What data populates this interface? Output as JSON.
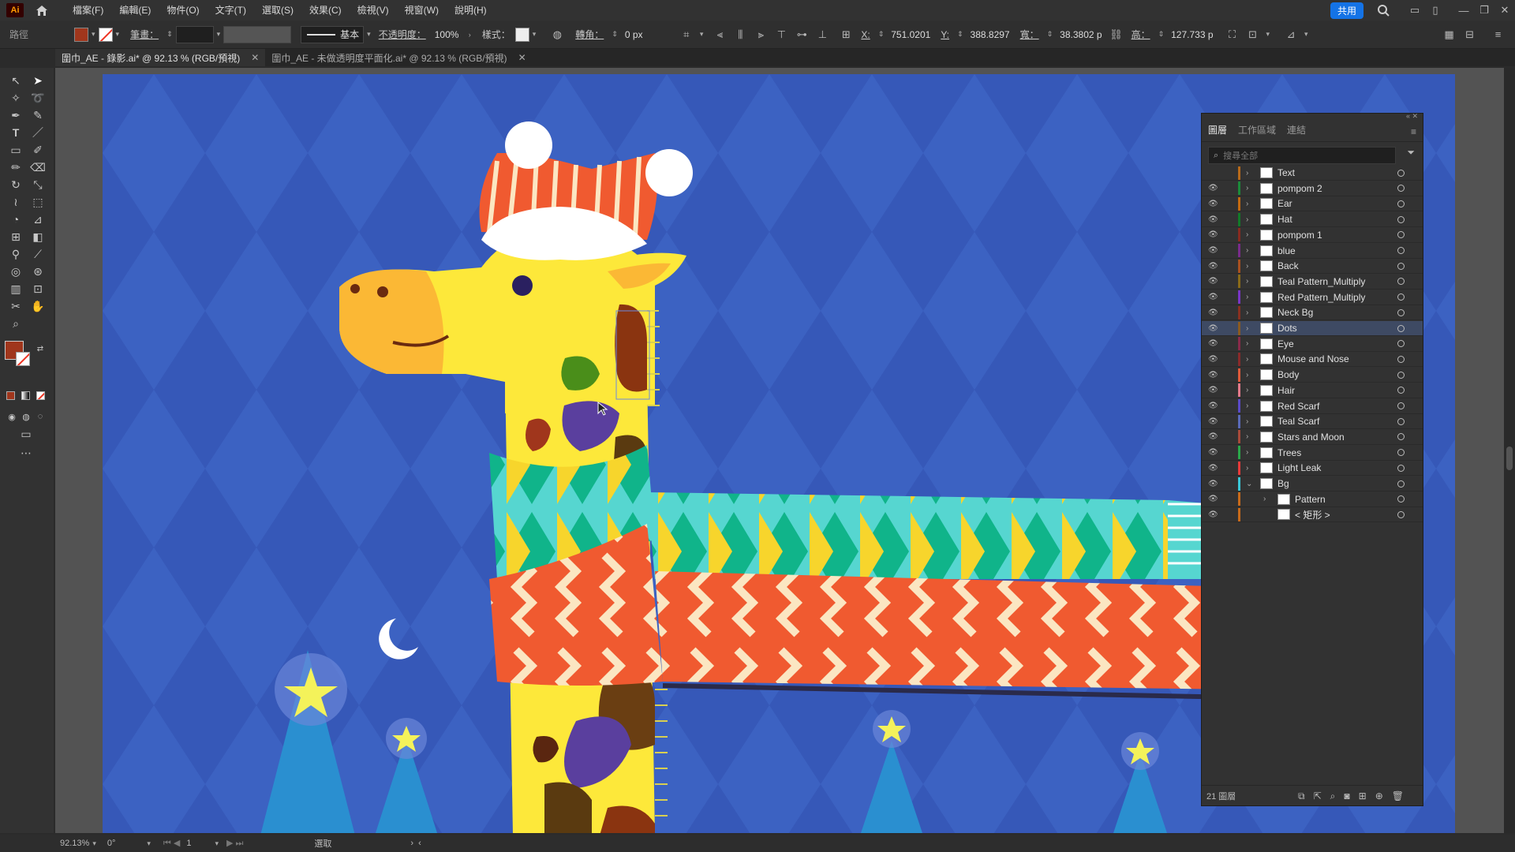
{
  "app": {
    "logo": "Ai"
  },
  "menu": [
    "檔案(F)",
    "編輯(E)",
    "物件(O)",
    "文字(T)",
    "選取(S)",
    "效果(C)",
    "檢視(V)",
    "視窗(W)",
    "說明(H)"
  ],
  "share_label": "共用",
  "control": {
    "path_label": "路徑",
    "stroke_label": "筆畫：",
    "stroke_style": "基本",
    "opacity_label": "不透明度：",
    "opacity_value": "100%",
    "style_label": "樣式：",
    "corner_label": "轉角：",
    "corner_value": "0 px",
    "x_label": "X:",
    "x_value": "751.0201",
    "y_label": "Y:",
    "y_value": "388.8297",
    "w_label": "寬：",
    "w_value": "38.3802 p",
    "h_label": "高：",
    "h_value": "127.733 p"
  },
  "tabs": [
    {
      "label": "圍巾_AE - 錄影.ai* @ 92.13 % (RGB/預視)",
      "active": true
    },
    {
      "label": "圍巾_AE - 未做透明度平面化.ai* @ 92.13 % (RGB/預視)",
      "active": false
    }
  ],
  "colors": {
    "artboard_bg": "#3658b8",
    "fill_swatch": "#a0361c",
    "accent": "#1473e6",
    "giraffe_yellow": "#fde83a",
    "scarf_red": "#f05a30",
    "scarf_teal": "#56d6d0"
  },
  "layers_panel": {
    "tabs": [
      "圖層",
      "工作區域",
      "連結"
    ],
    "search_placeholder": "搜尋全部",
    "footer_count": "21 圖層",
    "layers": [
      {
        "name": "Text",
        "color": "#b86a1a",
        "visible": false,
        "indent": 0,
        "chevron": "›"
      },
      {
        "name": "pompom 2",
        "color": "#1b8b3a",
        "visible": true,
        "indent": 0,
        "chevron": "›"
      },
      {
        "name": "Ear",
        "color": "#c46a10",
        "visible": true,
        "indent": 0,
        "chevron": "›"
      },
      {
        "name": "Hat",
        "color": "#127a28",
        "visible": true,
        "indent": 0,
        "chevron": "›"
      },
      {
        "name": "pompom 1",
        "color": "#8a2a1f",
        "visible": true,
        "indent": 0,
        "chevron": "›"
      },
      {
        "name": "blue",
        "color": "#7a2b8c",
        "visible": true,
        "indent": 0,
        "chevron": "›"
      },
      {
        "name": "Back",
        "color": "#a8501f",
        "visible": true,
        "indent": 0,
        "chevron": "›"
      },
      {
        "name": "Teal Pattern_Multiply",
        "color": "#8a6a18",
        "visible": true,
        "indent": 0,
        "chevron": "›"
      },
      {
        "name": "Red Pattern_Multiply",
        "color": "#7a35c6",
        "visible": true,
        "indent": 0,
        "chevron": "›"
      },
      {
        "name": "Neck Bg",
        "color": "#8a3020",
        "visible": true,
        "indent": 0,
        "chevron": "›"
      },
      {
        "name": "Dots",
        "color": "#8a5a20",
        "visible": true,
        "indent": 0,
        "chevron": "›",
        "selected": true
      },
      {
        "name": "Eye",
        "color": "#8a2a4a",
        "visible": true,
        "indent": 0,
        "chevron": "›"
      },
      {
        "name": "Mouse and Nose",
        "color": "#8a2a2a",
        "visible": true,
        "indent": 0,
        "chevron": "›"
      },
      {
        "name": "Body",
        "color": "#e05a3a",
        "visible": true,
        "indent": 0,
        "chevron": "›"
      },
      {
        "name": "Hair",
        "color": "#e47a8a",
        "visible": true,
        "indent": 0,
        "chevron": "›"
      },
      {
        "name": "Red Scarf",
        "color": "#5a4ac8",
        "visible": true,
        "indent": 0,
        "chevron": "›"
      },
      {
        "name": "Teal Scarf",
        "color": "#5a6ab8",
        "visible": true,
        "indent": 0,
        "chevron": "›"
      },
      {
        "name": "Stars and Moon",
        "color": "#a84a3a",
        "visible": true,
        "indent": 0,
        "chevron": "›"
      },
      {
        "name": "Trees",
        "color": "#2aa84a",
        "visible": true,
        "indent": 0,
        "chevron": "›"
      },
      {
        "name": "Light Leak",
        "color": "#e83a3a",
        "visible": true,
        "indent": 0,
        "chevron": "›"
      },
      {
        "name": "Bg",
        "color": "#3ac8d8",
        "visible": true,
        "indent": 0,
        "chevron": "⌄"
      },
      {
        "name": "Pattern",
        "color": "#c86a1a",
        "visible": true,
        "indent": 1,
        "chevron": "›"
      },
      {
        "name": "< 矩形 >",
        "color": "#c86a1a",
        "visible": true,
        "indent": 1,
        "chevron": ""
      }
    ]
  },
  "status": {
    "zoom": "92.13%",
    "rotate": "0°",
    "artboard_num": "1",
    "mode": "選取"
  }
}
